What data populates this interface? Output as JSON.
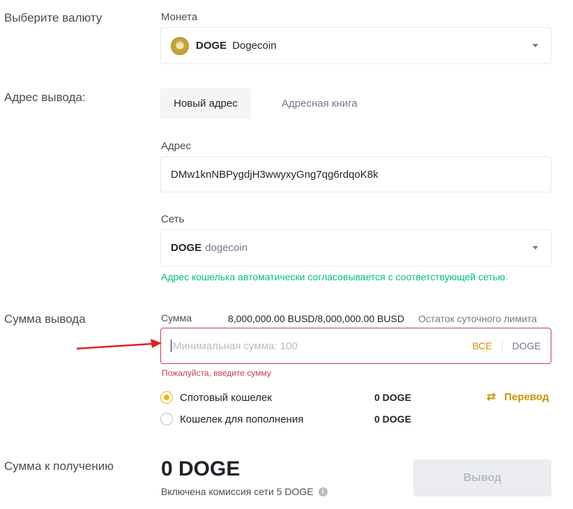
{
  "currency": {
    "section_label": "Выберите валюту",
    "field_label": "Монета",
    "selected_ticker": "DOGE",
    "selected_name": "Dogecoin",
    "coin_icon": "dogecoin-icon"
  },
  "address": {
    "section_label": "Адрес вывода:",
    "tabs": [
      {
        "label": "Новый адрес",
        "active": true
      },
      {
        "label": "Адресная книга",
        "active": false
      }
    ],
    "field_label": "Адрес",
    "value": "DMw1knNBPygdjH3wwyxyGng7qg6rdqoK8k"
  },
  "network": {
    "field_label": "Сеть",
    "selected_ticker": "DOGE",
    "selected_name": "dogecoin",
    "hint": "Адрес кошелька автоматически согласовывается с соответствующей сетью."
  },
  "amount": {
    "section_label": "Сумма вывода",
    "field_label": "Сумма",
    "limit_value": "8,000,000.00 BUSD/8,000,000.00 BUSD",
    "limit_label": "Остаток суточного лимита",
    "placeholder": "Минимальная сумма: 100",
    "max_label": "ВСЕ",
    "unit": "DOGE",
    "error": "Пожалуйста, введите сумму"
  },
  "wallets": [
    {
      "label": "Спотовый кошелек",
      "balance": "0 DOGE",
      "checked": true
    },
    {
      "label": "Кошелек для пополнения",
      "balance": "0 DOGE",
      "checked": false
    }
  ],
  "transfer_label": "Перевод",
  "receive": {
    "section_label": "Сумма к получению",
    "value": "0 DOGE",
    "fee_text": "Включена комиссия сети 5 DOGE"
  },
  "withdraw_button": "Вывод",
  "colors": {
    "accent": "#f0b90b",
    "accent_text": "#c99400",
    "error": "#c83c4d",
    "success": "#02c076",
    "annotation_arrow": "#e02020"
  }
}
